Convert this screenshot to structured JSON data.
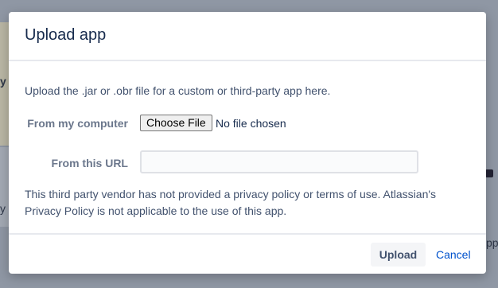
{
  "background": {
    "fragment_left_1": "y",
    "fragment_left_2": "y a",
    "fragment_right": "pp"
  },
  "dialog": {
    "title": "Upload app",
    "description": "Upload the .jar or .obr file for a custom or third-party app here.",
    "from_computer_label": "From my computer",
    "choose_file_label": "Choose File",
    "no_file_text": "No file chosen",
    "from_url_label": "From this URL",
    "url_value": "",
    "privacy_text": "This third party vendor has not provided a privacy policy or terms of use. Atlassian's Privacy Policy is not applicable to the use of this app.",
    "upload_label": "Upload",
    "cancel_label": "Cancel"
  },
  "colors": {
    "title": "#172b4d",
    "link": "#0052cc",
    "overlay": "#8f97a4"
  }
}
